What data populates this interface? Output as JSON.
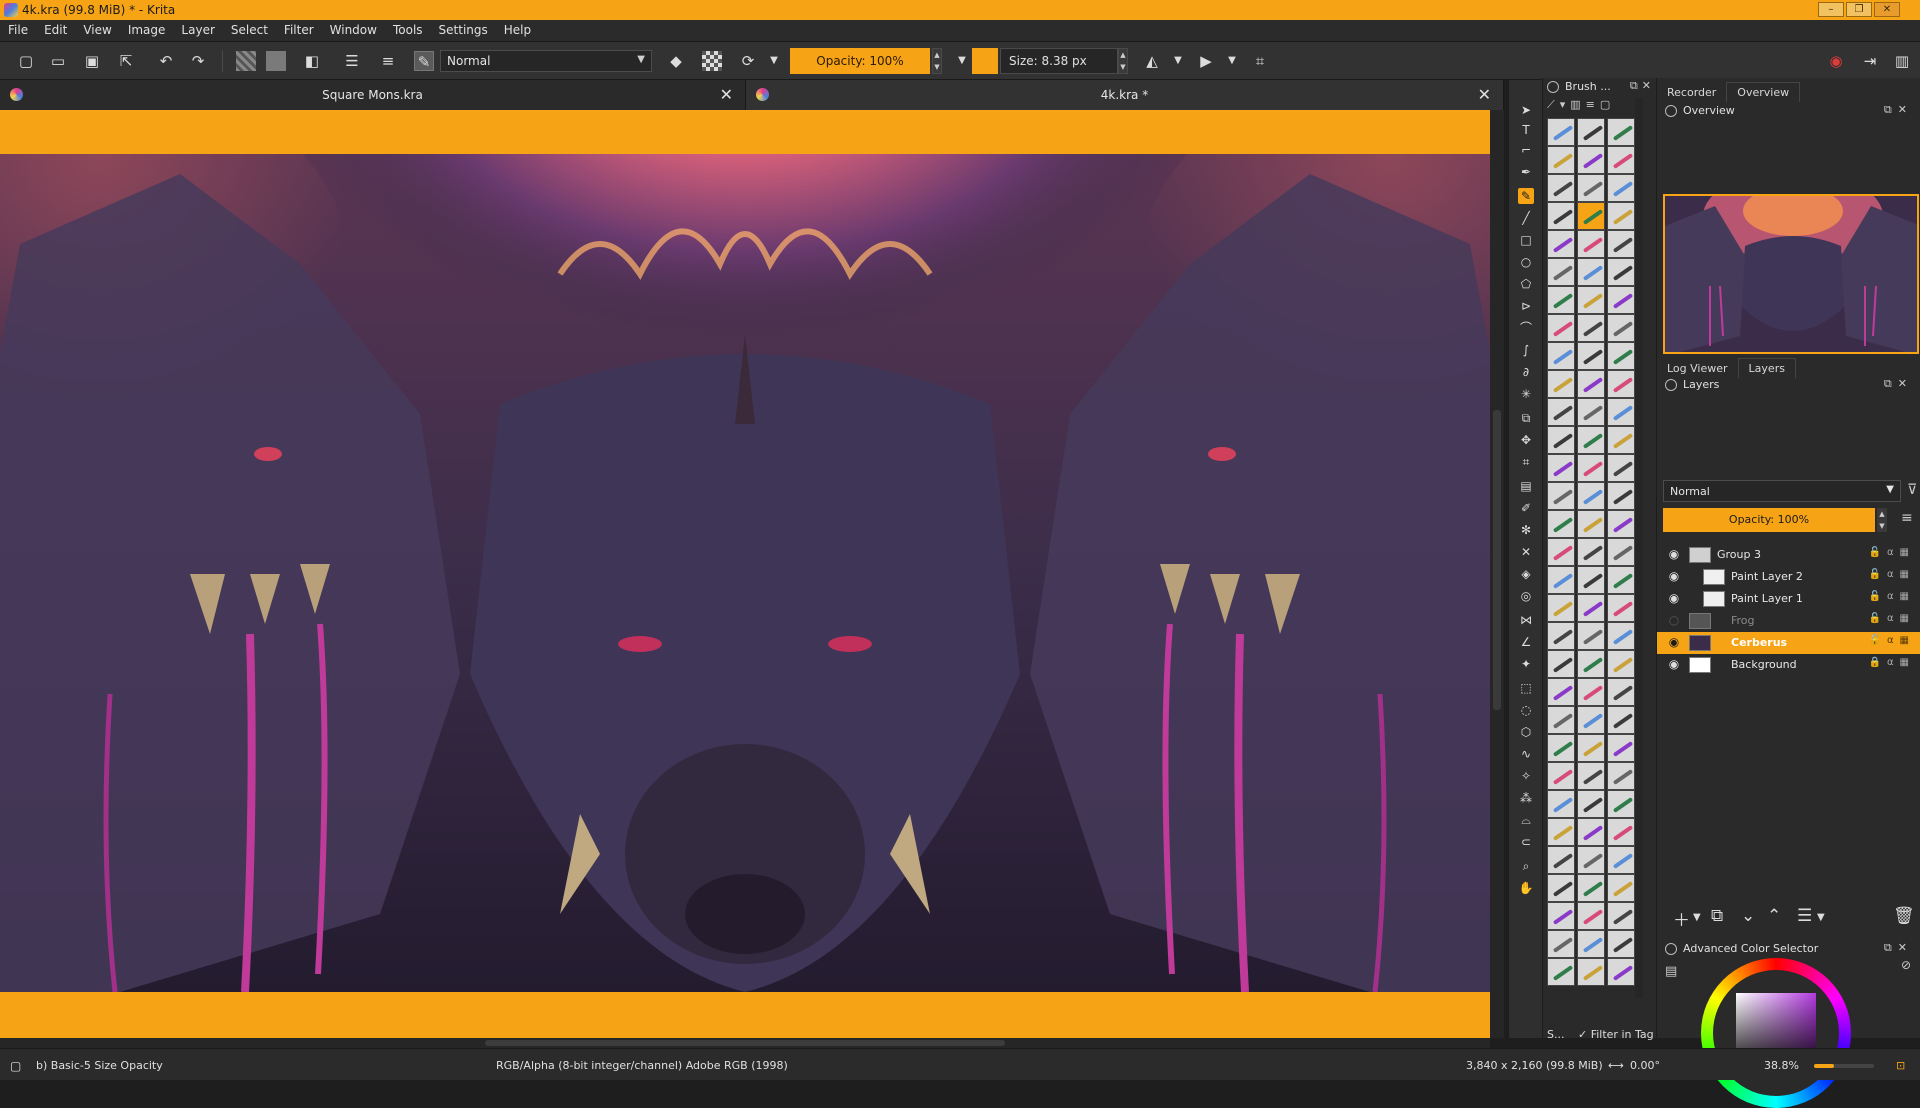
{
  "window": {
    "title": "4k.kra (99.8 MiB)  * - Krita",
    "controls": [
      "–",
      "❐",
      "✕"
    ]
  },
  "menu": [
    "File",
    "Edit",
    "View",
    "Image",
    "Layer",
    "Select",
    "Filter",
    "Window",
    "Tools",
    "Settings",
    "Help"
  ],
  "toolbar": {
    "blend_mode": "Normal",
    "opacity_label": "Opacity: 100%",
    "size_label": "Size: 8.38 px",
    "accent_color": "#f6a316"
  },
  "tabs": [
    {
      "label": "Square Mons.kra"
    },
    {
      "label": "4k.kra *"
    }
  ],
  "brush_docker": {
    "title": "Brush ...",
    "footer_left": "S...",
    "filter_label": "Filter in Tag"
  },
  "right_panel": {
    "top_tabs": [
      "Recorder",
      "Overview"
    ],
    "overview_title": "Overview",
    "mid_tabs": [
      "Log Viewer",
      "Layers"
    ],
    "layers_title": "Layers",
    "layer_blend": "Normal",
    "layer_opacity": "Opacity:  100%",
    "layers": [
      {
        "name": "Group 3",
        "visible": true,
        "active": false
      },
      {
        "name": "Paint Layer 2",
        "visible": true,
        "active": false
      },
      {
        "name": "Paint Layer 1",
        "visible": true,
        "active": false
      },
      {
        "name": "Frog",
        "visible": false,
        "active": false
      },
      {
        "name": "Cerberus",
        "visible": true,
        "active": true
      },
      {
        "name": "Background",
        "visible": true,
        "active": false
      }
    ],
    "color_selector_title": "Advanced Color Selector"
  },
  "status": {
    "brush": "b) Basic-5 Size Opacity",
    "color_space": "RGB/Alpha (8-bit integer/channel)  Adobe RGB (1998)",
    "dimensions": "3,840 x 2,160 (99.8 MiB)",
    "rotation": "0.00°",
    "zoom": "38.8%"
  }
}
